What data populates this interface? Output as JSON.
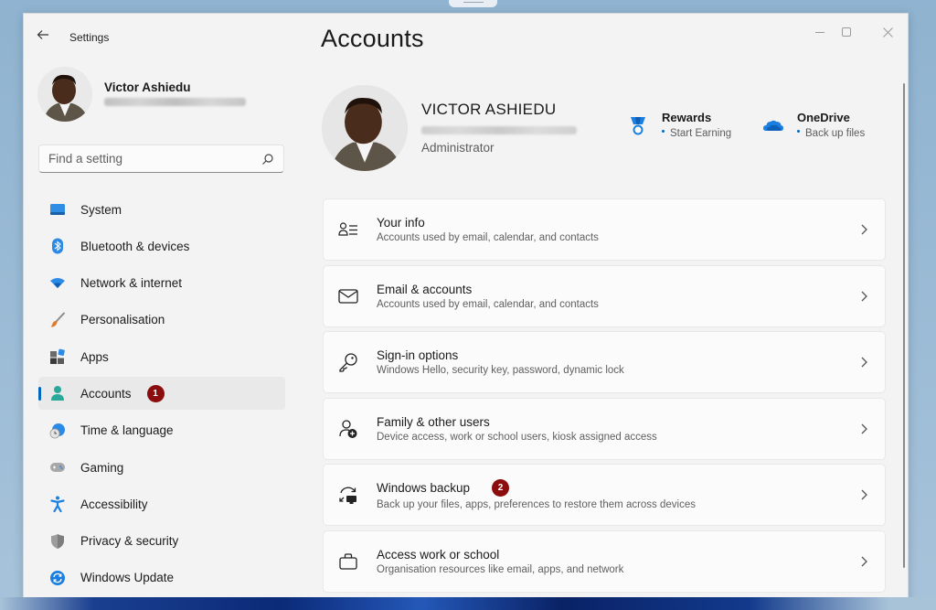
{
  "window": {
    "app_title": "Settings",
    "controls": {
      "minimize": "minimize",
      "maximize": "maximize",
      "close": "close"
    }
  },
  "user": {
    "name": "Victor Ashiedu",
    "name_upper": "VICTOR ASHIEDU",
    "email_obscured": true,
    "role": "Administrator"
  },
  "search": {
    "placeholder": "Find a setting",
    "value": ""
  },
  "sidebar": {
    "items": [
      {
        "label": "System",
        "icon": "monitor-icon"
      },
      {
        "label": "Bluetooth & devices",
        "icon": "bluetooth-icon"
      },
      {
        "label": "Network & internet",
        "icon": "wifi-icon"
      },
      {
        "label": "Personalisation",
        "icon": "brush-icon"
      },
      {
        "label": "Apps",
        "icon": "apps-icon"
      },
      {
        "label": "Accounts",
        "icon": "person-icon",
        "active": true,
        "badge": "1"
      },
      {
        "label": "Time & language",
        "icon": "globe-clock-icon"
      },
      {
        "label": "Gaming",
        "icon": "gamepad-icon"
      },
      {
        "label": "Accessibility",
        "icon": "accessibility-icon"
      },
      {
        "label": "Privacy & security",
        "icon": "shield-icon"
      },
      {
        "label": "Windows Update",
        "icon": "update-icon"
      }
    ]
  },
  "main": {
    "title": "Accounts",
    "promos": [
      {
        "title": "Rewards",
        "subtitle": "Start Earning",
        "icon": "medal-icon"
      },
      {
        "title": "OneDrive",
        "subtitle": "Back up files",
        "icon": "cloud-icon"
      }
    ],
    "cards": [
      {
        "title": "Your info",
        "subtitle": "Accounts used by email, calendar, and contacts",
        "icon": "person-list-icon"
      },
      {
        "title": "Email & accounts",
        "subtitle": "Accounts used by email, calendar, and contacts",
        "icon": "mail-icon"
      },
      {
        "title": "Sign-in options",
        "subtitle": "Windows Hello, security key, password, dynamic lock",
        "icon": "key-icon"
      },
      {
        "title": "Family & other users",
        "subtitle": "Device access, work or school users, kiosk assigned access",
        "icon": "person-add-icon"
      },
      {
        "title": "Windows backup",
        "subtitle": "Back up your files, apps, preferences to restore them across devices",
        "icon": "backup-icon",
        "badge": "2"
      },
      {
        "title": "Access work or school",
        "subtitle": "Organisation resources like email, apps, and network",
        "icon": "briefcase-icon"
      }
    ]
  },
  "colors": {
    "accent": "#0067c0",
    "badge": "#8b0d0d",
    "window_bg": "#f3f3f3",
    "card_bg": "#fbfbfb"
  }
}
